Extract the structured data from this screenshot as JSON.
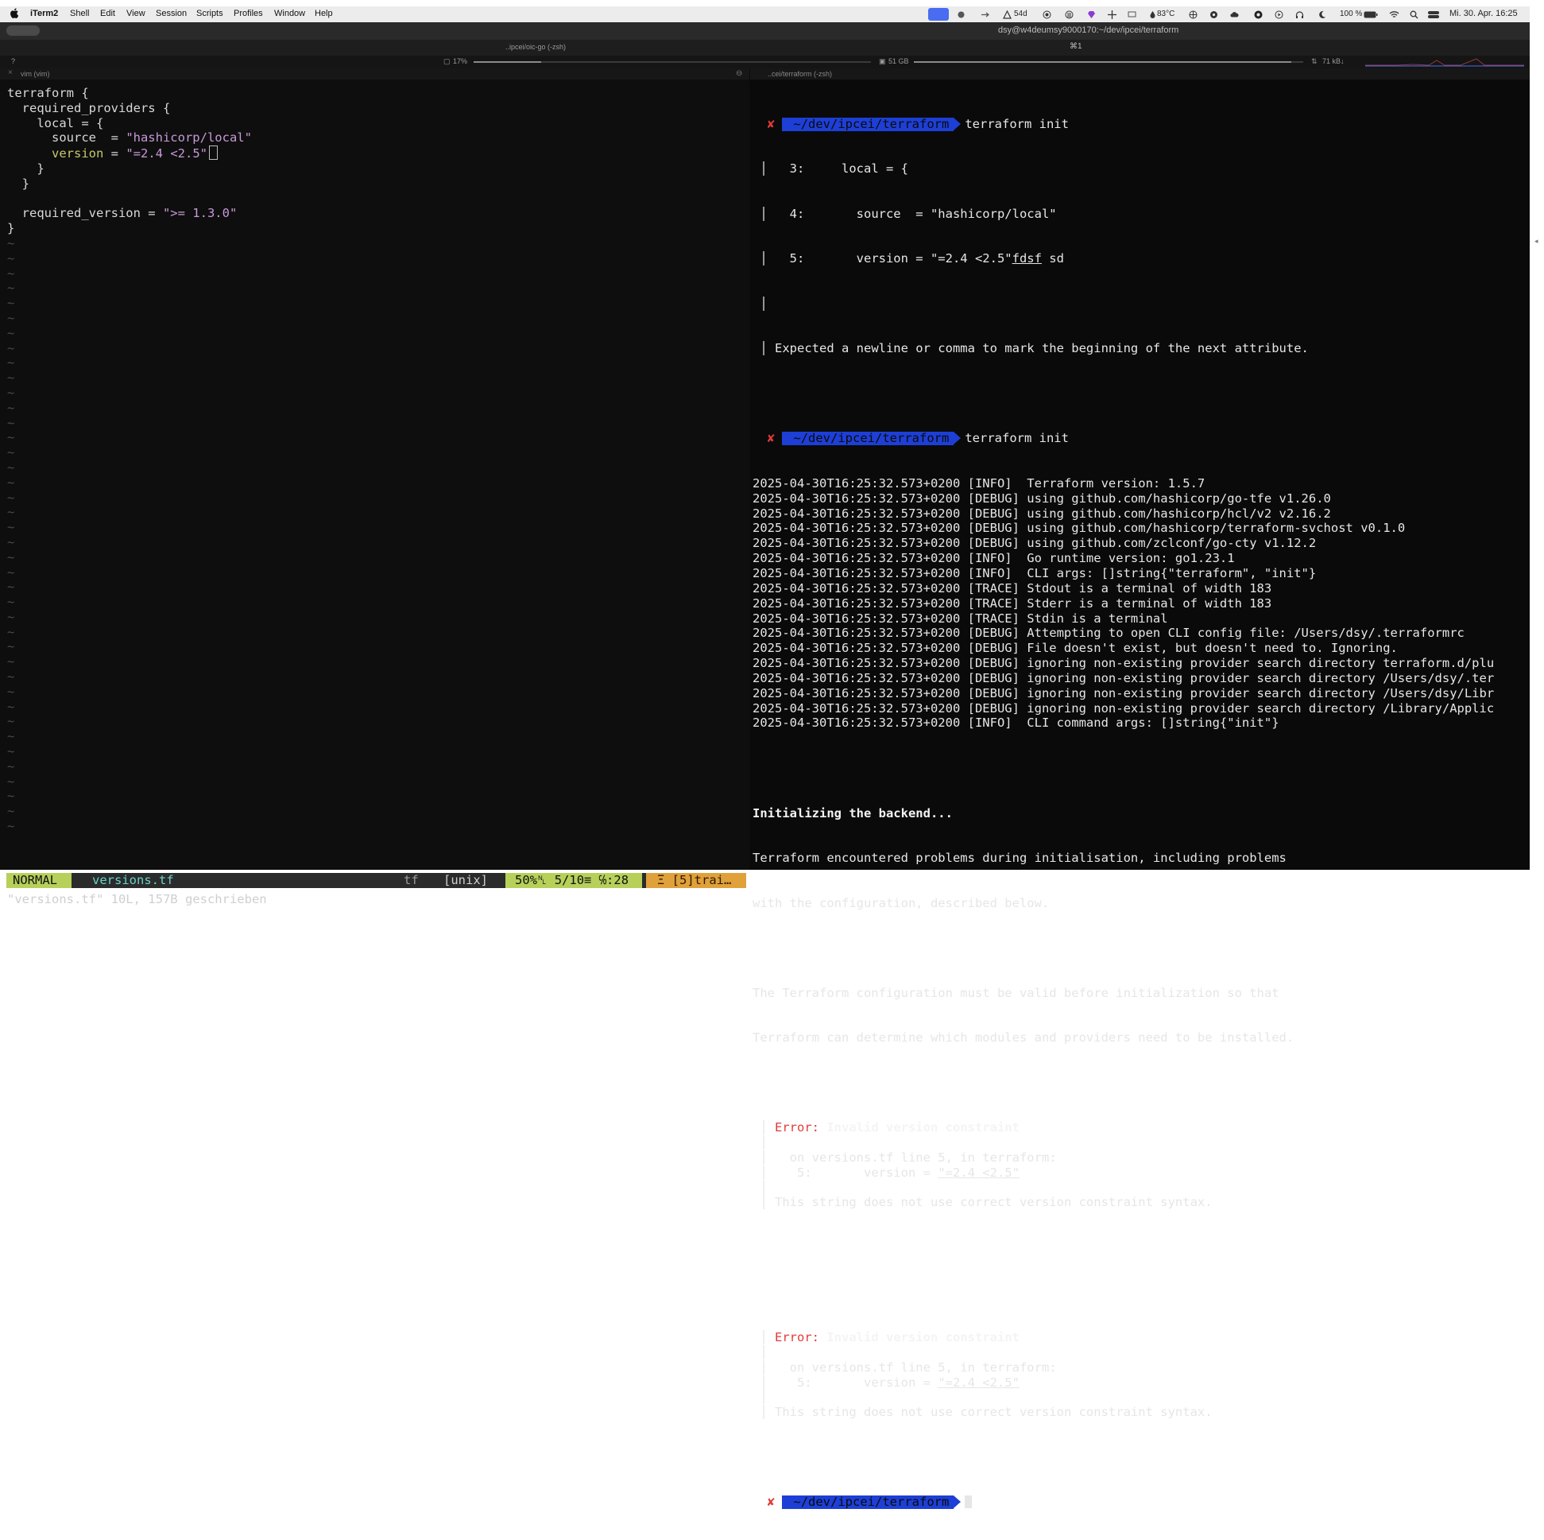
{
  "menubar": {
    "app_name": "iTerm2",
    "items": [
      "Shell",
      "Edit",
      "View",
      "Session",
      "Scripts",
      "Profiles",
      "Window",
      "Help"
    ],
    "status": {
      "battery_days": "54d",
      "temperature": "83°C",
      "battery_percent": "100 %",
      "datetime": "Mi. 30. Apr.  16:25"
    }
  },
  "window": {
    "title": "dsy@w4deumsy9000170:~/dev/ipcei/terraform",
    "tab_label": "..ipcei/oic-go (-zsh)",
    "tab_close": "⌘1"
  },
  "infobar": {
    "question": "?",
    "cpu": "17%",
    "cpu_value": 0.17,
    "memory": "51 GB",
    "memory_value": 0.97,
    "network": "71 kB↓"
  },
  "left_pane": {
    "header_close": "×",
    "header_title": "vim (vim)",
    "code": {
      "l1": "terraform {",
      "l2_key": "  required_providers {",
      "l3": "    local = {",
      "l4_key": "      source  = ",
      "l4_val": "\"hashicorp/local\"",
      "l5_key": "      version",
      "l5_eq": " = ",
      "l5_val": "\"=2.4 <2.5\"",
      "l6": "    }",
      "l7": "  }",
      "l8": "",
      "l9_key": "  required_version = ",
      "l9_val": "\">= 1.3.0\"",
      "l10": "}"
    },
    "tilde": "~",
    "status": {
      "mode": "NORMAL",
      "file": "versions.tf",
      "filetype": "tf",
      "format": "[unix]",
      "position": "50%␤ 5/10≡ ℅:28",
      "warning": "Ξ [5]trai…"
    },
    "cmdline": "\"versions.tf\" 10L, 157B geschrieben"
  },
  "right_pane": {
    "header_title": "..cei/terraform (-zsh)",
    "prompt_x": "✘",
    "prompt_path": "~/dev/ipcei/terraform",
    "cmd": "terraform init",
    "early": {
      "l1": "   3:     local = {",
      "l2": "   4:       source  = \"hashicorp/local\"",
      "l3a": "   5:       version = \"=2.4 <2.5\"",
      "l3b": "fdsf",
      "l3c": " sd",
      "l4": "Expected a newline or comma to mark the beginning of the next attribute."
    },
    "log": [
      "2025-04-30T16:25:32.573+0200 [INFO]  Terraform version: 1.5.7",
      "2025-04-30T16:25:32.573+0200 [DEBUG] using github.com/hashicorp/go-tfe v1.26.0",
      "2025-04-30T16:25:32.573+0200 [DEBUG] using github.com/hashicorp/hcl/v2 v2.16.2",
      "2025-04-30T16:25:32.573+0200 [DEBUG] using github.com/hashicorp/terraform-svchost v0.1.0",
      "2025-04-30T16:25:32.573+0200 [DEBUG] using github.com/zclconf/go-cty v1.12.2",
      "2025-04-30T16:25:32.573+0200 [INFO]  Go runtime version: go1.23.1",
      "2025-04-30T16:25:32.573+0200 [INFO]  CLI args: []string{\"terraform\", \"init\"}",
      "2025-04-30T16:25:32.573+0200 [TRACE] Stdout is a terminal of width 183",
      "2025-04-30T16:25:32.573+0200 [TRACE] Stderr is a terminal of width 183",
      "2025-04-30T16:25:32.573+0200 [TRACE] Stdin is a terminal",
      "2025-04-30T16:25:32.573+0200 [DEBUG] Attempting to open CLI config file: /Users/dsy/.terraformrc",
      "2025-04-30T16:25:32.573+0200 [DEBUG] File doesn't exist, but doesn't need to. Ignoring.",
      "2025-04-30T16:25:32.573+0200 [DEBUG] ignoring non-existing provider search directory terraform.d/plu",
      "2025-04-30T16:25:32.573+0200 [DEBUG] ignoring non-existing provider search directory /Users/dsy/.ter",
      "2025-04-30T16:25:32.573+0200 [DEBUG] ignoring non-existing provider search directory /Users/dsy/Libr",
      "2025-04-30T16:25:32.573+0200 [DEBUG] ignoring non-existing provider search directory /Library/Applic",
      "2025-04-30T16:25:32.573+0200 [INFO]  CLI command args: []string{\"init\"}"
    ],
    "backend_title": "Initializing the backend...",
    "msg1": "Terraform encountered problems during initialisation, including problems",
    "msg2": "with the configuration, described below.",
    "msg3": "The Terraform configuration must be valid before initialization so that",
    "msg4": "Terraform can determine which modules and providers need to be installed.",
    "error_label": "Error: ",
    "error_title": "Invalid version constraint",
    "error_loc": "  on versions.tf line 5, in terraform:",
    "error_line_prefix": "   5:       version = ",
    "error_line_value": "\"=2.4 <2.5\"",
    "error_detail": "This string does not use correct version constraint syntax."
  },
  "colors": {
    "prompt_bg": "#1d3fd6",
    "vim_mode": "#b7d05a",
    "error_red": "#e23a3a"
  }
}
